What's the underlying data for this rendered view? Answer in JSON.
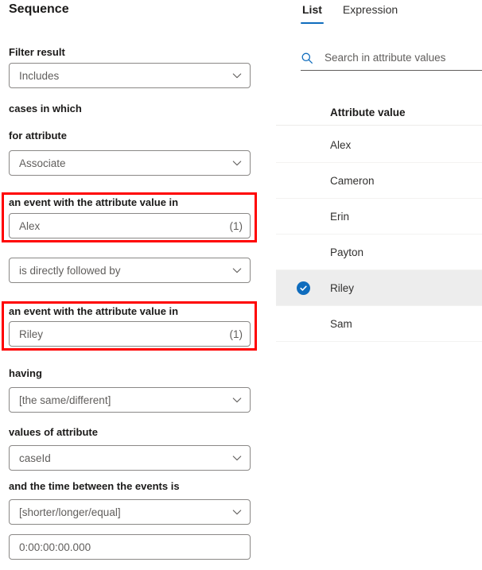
{
  "left": {
    "title": "Sequence",
    "fields": [
      {
        "label": "Filter result",
        "kind": "dropdown",
        "value": "Includes",
        "icon": "chevron-down-icon",
        "name": "filter-result"
      },
      {
        "label": "cases in which",
        "kind": "label-only",
        "name": "cases-in-which"
      },
      {
        "label": "for attribute",
        "kind": "dropdown",
        "value": "Associate",
        "icon": "chevron-down-icon",
        "name": "for-attribute"
      },
      {
        "label": "an event with the attribute value in",
        "kind": "input",
        "value": "Alex",
        "count": "(1)",
        "highlighted": true,
        "name": "first-event-attribute-value"
      },
      {
        "label": "",
        "kind": "dropdown",
        "value": "is directly followed by",
        "icon": "chevron-down-icon",
        "name": "relation-operator"
      },
      {
        "label": "an event with the attribute value in",
        "kind": "input",
        "value": "Riley",
        "count": "(1)",
        "highlighted": true,
        "name": "second-event-attribute-value"
      },
      {
        "label": "having",
        "kind": "dropdown",
        "value": "[the same/different]",
        "icon": "chevron-down-icon",
        "name": "having"
      },
      {
        "label": "values of attribute",
        "kind": "dropdown",
        "value": "caseId",
        "icon": "chevron-down-icon",
        "name": "values-of-attribute"
      },
      {
        "label": "and the time between the events is",
        "kind": "dropdown",
        "value": "[shorter/longer/equal]",
        "icon": "chevron-down-icon",
        "name": "time-comparison"
      },
      {
        "label": "",
        "kind": "input",
        "value": "0:00:00:00.000",
        "name": "time-duration"
      }
    ]
  },
  "right": {
    "tabs": [
      {
        "label": "List",
        "active": true,
        "name": "tab-list"
      },
      {
        "label": "Expression",
        "active": false,
        "name": "tab-expression"
      }
    ],
    "search": {
      "placeholder": "Search in attribute values",
      "value": "",
      "icon": "search-icon"
    },
    "list_header": "Attribute value",
    "items": [
      {
        "label": "Alex",
        "selected": false
      },
      {
        "label": "Cameron",
        "selected": false
      },
      {
        "label": "Erin",
        "selected": false
      },
      {
        "label": "Payton",
        "selected": false
      },
      {
        "label": "Riley",
        "selected": true
      },
      {
        "label": "Sam",
        "selected": false
      }
    ]
  },
  "colors": {
    "accent": "#0f6cbd",
    "highlight": "#ff0000",
    "selected_row_bg": "#ededed",
    "border": "#8a8886",
    "text": "#201f1e",
    "muted_text": "#605e5c"
  }
}
